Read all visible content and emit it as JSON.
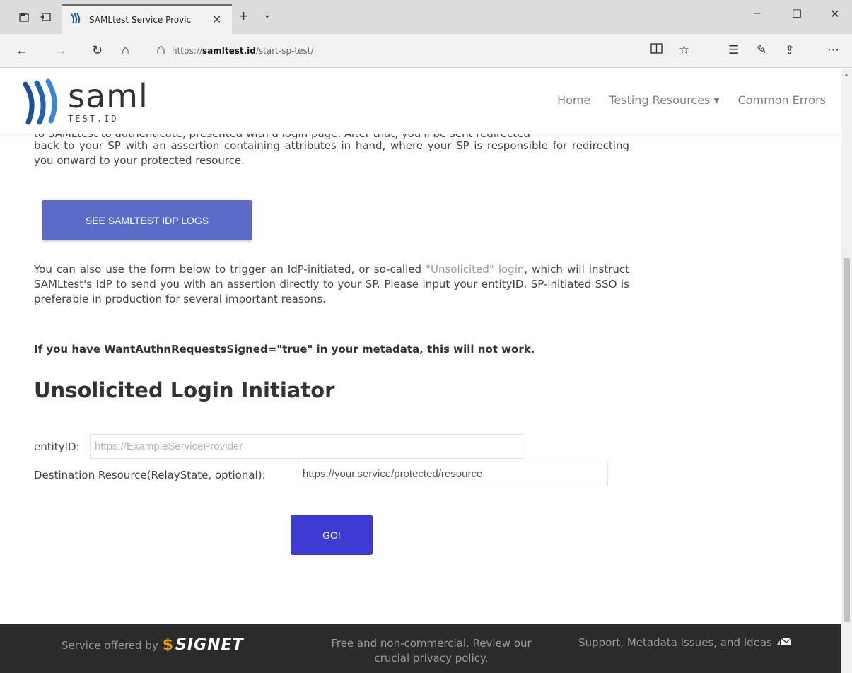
{
  "browser": {
    "tab_title": "SAMLtest Service Provic",
    "tab_close": "✕",
    "new_tab": "+",
    "tab_menu": "⌄",
    "url_prefix": "https://",
    "url_host": "samltest.id",
    "url_path": "/start-sp-test/",
    "window_controls": [
      "–",
      "☐",
      "✕"
    ]
  },
  "site": {
    "logo_word": "saml",
    "logo_sub": "TEST.ID",
    "nav": [
      "Home",
      "Testing Resources ▾",
      "Common Errors"
    ]
  },
  "content": {
    "intro_cut": "to SAMLtest to authenticate, presented with a login page. After that, you'll be sent redirected",
    "intro_para": "back to your SP with an assertion containing attributes in hand, where your SP is responsible for redirecting you onward to your protected resource.",
    "logs_button": "SEE SAMLTEST IDP LOGS",
    "para2_before": "You can also use the form below to trigger an IdP-initiated, or so-called ",
    "para2_link": "\"Unsolicited\" login",
    "para2_after": ", which will instruct SAMLtest's IdP to send you with an assertion directly to your SP. Please input your entityID. SP-initiated SSO is preferable in production for several important reasons.",
    "warning": "If you have WantAuthnRequestsSigned=\"true\" in your metadata, this will not work.",
    "heading": "Unsolicited Login Initiator",
    "entity_label": "entityID:",
    "entity_placeholder": "https://ExampleServiceProvider",
    "relay_label": "Destination Resource(RelayState, optional):",
    "relay_value": "https://your.service/protected/resource",
    "go_button": "GO!"
  },
  "footer": {
    "offered_by": "Service offered by",
    "signet": "SIGNET",
    "signet_mark": "$",
    "middle": "Free and non-commercial. Review our crucial privacy policy.",
    "right": "Support, Metadata Issues, and Ideas"
  }
}
